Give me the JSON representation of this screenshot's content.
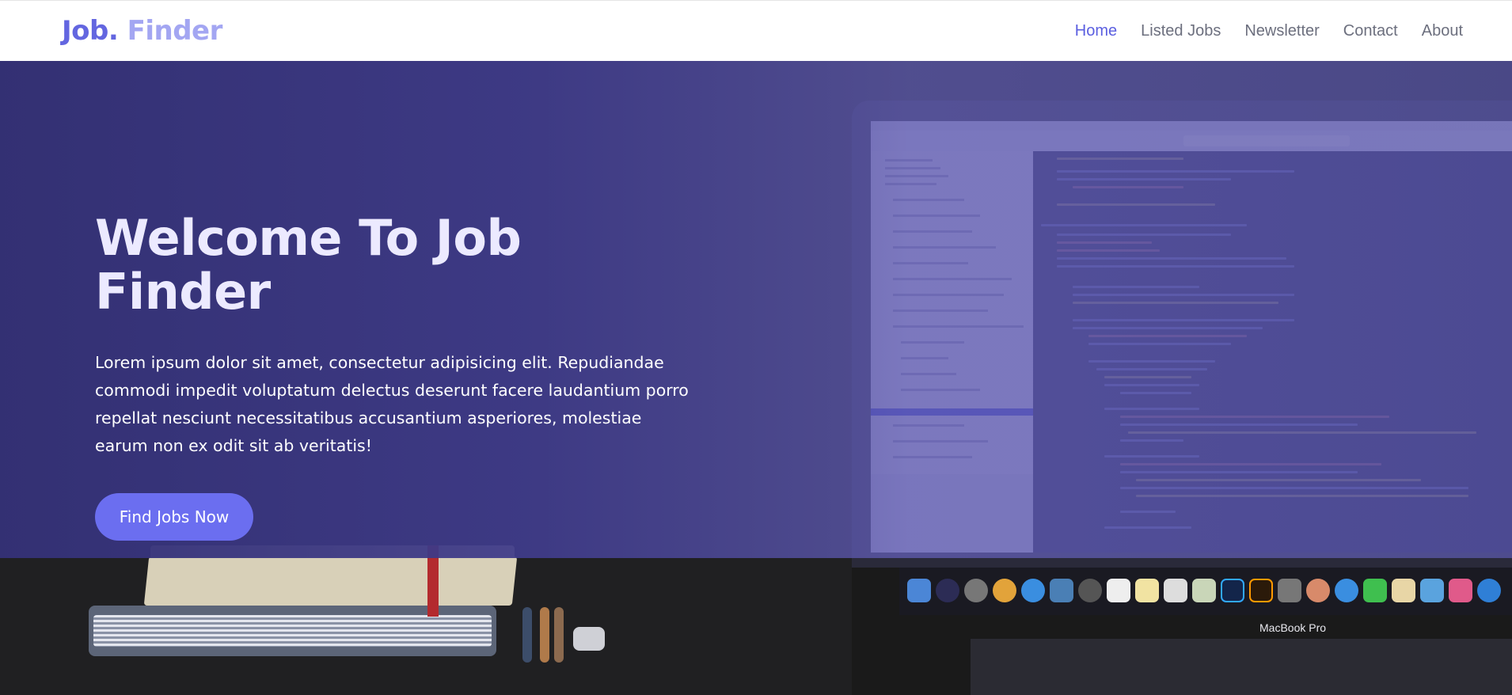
{
  "brand": {
    "part1": "Job.",
    "part2": "Finder"
  },
  "nav": {
    "items": [
      {
        "label": "Home",
        "active": true
      },
      {
        "label": "Listed Jobs",
        "active": false
      },
      {
        "label": "Newsletter",
        "active": false
      },
      {
        "label": "Contact",
        "active": false
      },
      {
        "label": "About",
        "active": false
      }
    ]
  },
  "hero": {
    "title": "Welcome To Job Finder",
    "text": "Lorem ipsum dolor sit amet, consectetur adipisicing elit. Repudiandae commodi impedit voluptatum delectus deserunt facere laudantium porro repellat nesciunt necessitatibus accusantium asperiores, molestiae earum non ex odit sit ab veritatis!",
    "cta_label": "Find Jobs Now",
    "image_caption": "MacBook Pro"
  },
  "colors": {
    "brand_primary": "#6366e0",
    "brand_secondary": "#a3a6f2",
    "nav_active": "#5b5fe0",
    "nav_text": "#6c6f7e",
    "cta_bg": "#6b6ef0",
    "overlay": "#433f90"
  }
}
